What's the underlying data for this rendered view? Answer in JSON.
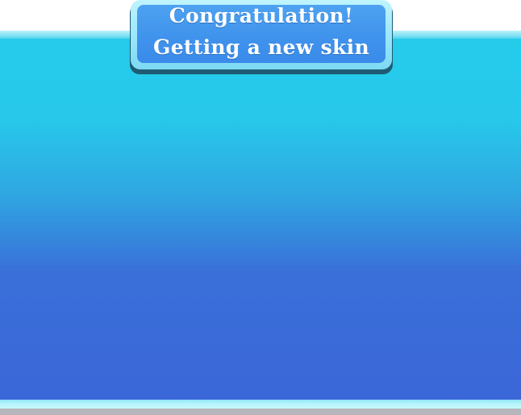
{
  "banner": {
    "line1": "Congratulation!",
    "line2": "Getting a new skin"
  },
  "colors": {
    "panel_top": "#26cbea",
    "panel_bottom": "#3b67d8",
    "banner_fill": "#3f92ec",
    "banner_rim": "#9be8fa",
    "bottom_strip": "#b4b6bb"
  }
}
